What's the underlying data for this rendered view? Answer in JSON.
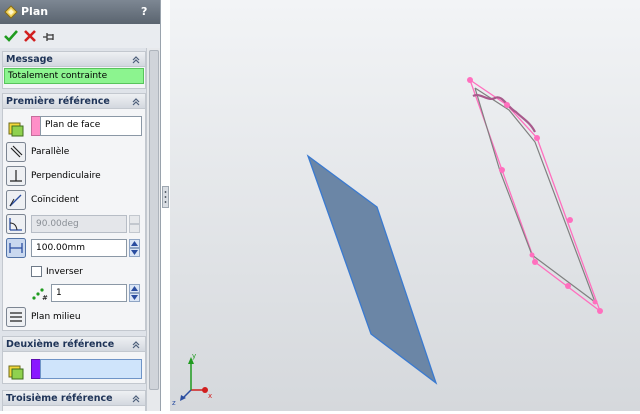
{
  "window": {
    "title": "Plan",
    "help_label": "?"
  },
  "toolbar": {
    "ok_icon": "check-icon",
    "cancel_icon": "x-icon",
    "pushpin_icon": "pushpin-icon"
  },
  "message_section": {
    "title": "Message",
    "text": "Totalement contrainte",
    "status_color": "#8cf48f"
  },
  "first_reference": {
    "title": "Première référence",
    "selection": "Plan de face",
    "selection_color": "#ff8fc8",
    "options": {
      "parallel": "Parallèle",
      "perpendicular": "Perpendiculaire",
      "coincident": "Coïncident"
    },
    "angle_value": "90.00deg",
    "distance_value": "100.00mm",
    "flip_label": "Inverser",
    "instances_value": "1",
    "mid_plane_label": "Plan milieu"
  },
  "second_reference": {
    "title": "Deuxième référence",
    "selection": "",
    "selection_color": "#8a17ff"
  },
  "third_reference": {
    "title": "Troisième référence"
  },
  "viewport": {
    "preview_color": "#ff6fbe",
    "plane_fill": "#6b86a6",
    "plane_edge": "#3a7ad0",
    "triad_axes": [
      "x",
      "y",
      "z"
    ]
  }
}
